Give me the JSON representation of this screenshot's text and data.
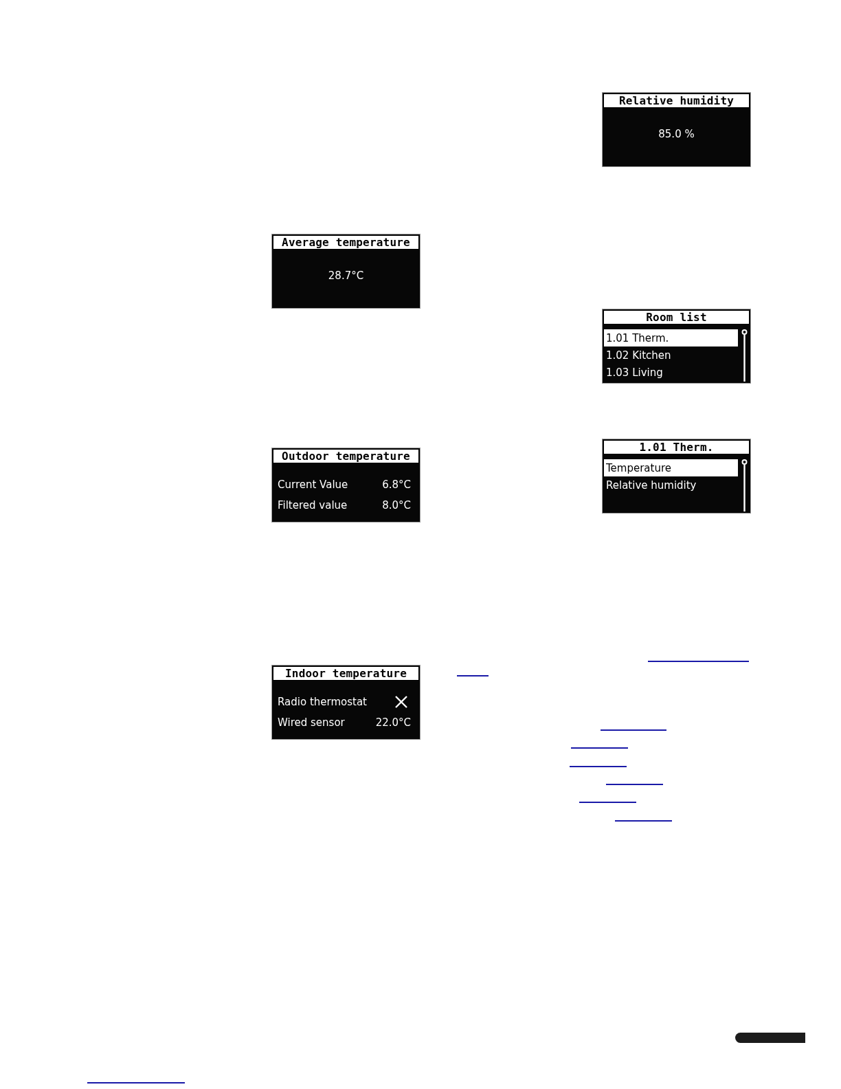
{
  "left_column": [
    {
      "kind": "value",
      "title": "Average temperature",
      "value": "28.7°C"
    },
    {
      "kind": "rows",
      "title": "Outdoor temperature",
      "rows": [
        {
          "kind": "value",
          "label": "Current Value",
          "value": "6.8°C"
        },
        {
          "kind": "value",
          "label": "Filtered value",
          "value": "8.0°C"
        }
      ]
    },
    {
      "kind": "rows",
      "title": "Indoor temperature",
      "rows": [
        {
          "kind": "cross",
          "label": "Radio thermostat"
        },
        {
          "kind": "value",
          "label": "Wired sensor",
          "value": "22.0°C"
        }
      ]
    }
  ],
  "right_column": [
    {
      "kind": "value",
      "title": "Relative humidity",
      "value": "85.0 %"
    },
    {
      "kind": "list",
      "title": "Room list",
      "items": [
        {
          "label": "1.01 Therm.",
          "selected": true
        },
        {
          "label": "1.02 Kitchen",
          "selected": false
        },
        {
          "label": "1.03 Living",
          "selected": false
        }
      ]
    },
    {
      "kind": "list",
      "title": "1.01 Therm.",
      "items": [
        {
          "label": "Temperature",
          "selected": true
        },
        {
          "label": "Relative humidity",
          "selected": false
        }
      ]
    }
  ]
}
